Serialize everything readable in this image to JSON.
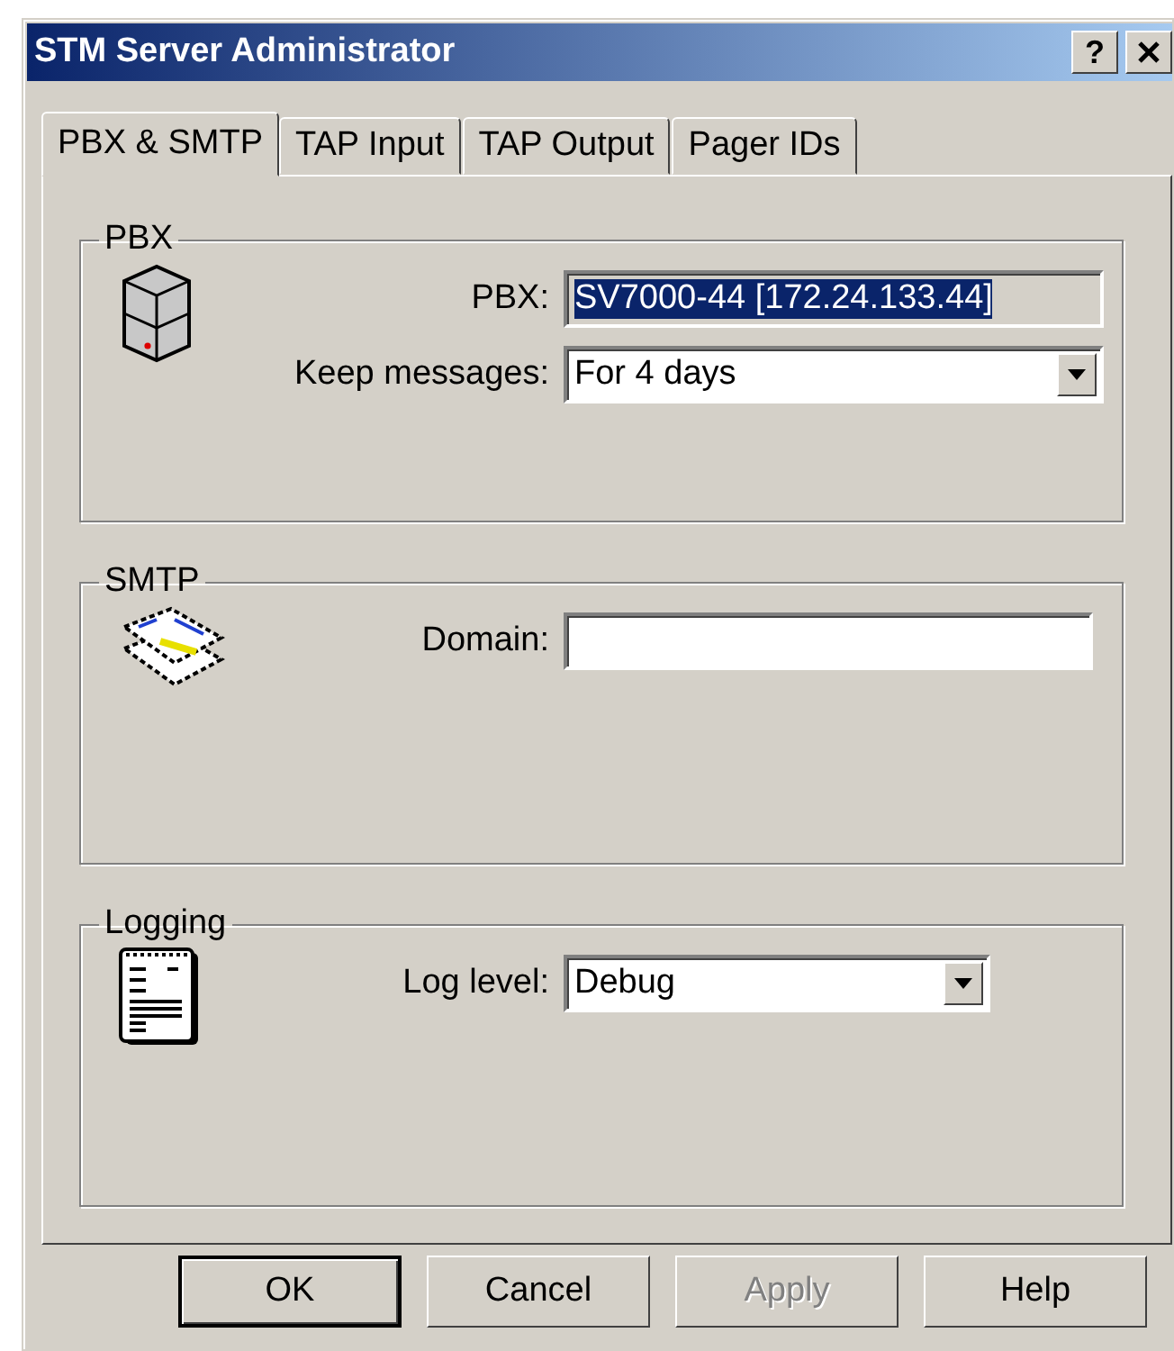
{
  "window": {
    "title": "STM Server Administrator",
    "help_button": "?"
  },
  "tabs": [
    {
      "label": "PBX & SMTP",
      "selected": true
    },
    {
      "label": "TAP Input",
      "selected": false
    },
    {
      "label": "TAP Output",
      "selected": false
    },
    {
      "label": "Pager IDs",
      "selected": false
    }
  ],
  "groups": [
    {
      "title": "PBX",
      "fields": [
        {
          "kind": "readonly",
          "label": "PBX:",
          "value": "SV7000-44 [172.24.133.44]",
          "highlighted": true
        },
        {
          "kind": "dropdown",
          "label": "Keep messages:",
          "value": "For 4 days"
        }
      ]
    },
    {
      "title": "SMTP",
      "fields": [
        {
          "kind": "input",
          "label": "Domain:"
        }
      ]
    },
    {
      "title": "Logging",
      "fields": [
        {
          "kind": "dropdown",
          "label": "Log level:",
          "value": "Debug"
        }
      ]
    }
  ],
  "buttons": [
    {
      "label": "OK",
      "default": true,
      "disabled": false
    },
    {
      "label": "Cancel",
      "default": false,
      "disabled": false
    },
    {
      "label": "Apply",
      "default": false,
      "disabled": true
    },
    {
      "label": "Help",
      "default": false,
      "disabled": false
    }
  ]
}
